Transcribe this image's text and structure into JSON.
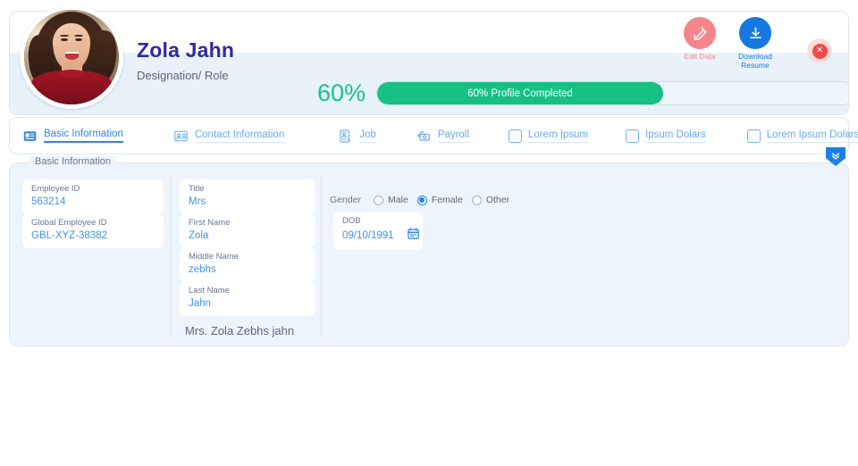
{
  "header": {
    "name": "Zola Jahn",
    "role": "Designation/ Role",
    "avatar_icon": "user-avatar-photo",
    "actions": [
      {
        "id": "edit-data",
        "label": "Edit Data",
        "icon": "pencil-square-icon",
        "color": "#f4868b"
      },
      {
        "id": "download-resume",
        "label": "Download Resume",
        "icon": "download-icon",
        "color": "#1678e0"
      }
    ],
    "close_icon": "close-icon"
  },
  "progress": {
    "percent_label": "60%",
    "bar_text": "60% Profile Completed",
    "value": 60,
    "fill_color": "#17c083",
    "track_color": "#eef5fb"
  },
  "tabs": [
    {
      "label": "Basic Information",
      "icon": "article-card-icon",
      "active": true,
      "type": "icon"
    },
    {
      "label": "Contact Information",
      "icon": "id-card-icon",
      "active": false,
      "type": "icon"
    },
    {
      "label": "Job",
      "icon": "job-badge-icon",
      "active": false,
      "type": "icon"
    },
    {
      "label": "Payroll",
      "icon": "payroll-money-icon",
      "active": false,
      "type": "icon"
    },
    {
      "label": "Lorem Ipsum",
      "icon": "checkbox-icon",
      "active": false,
      "type": "checkbox"
    },
    {
      "label": "Ipsum Dolars",
      "icon": "checkbox-icon",
      "active": false,
      "type": "checkbox"
    },
    {
      "label": "Lorem Ipsum Dolars",
      "icon": "checkbox-icon",
      "active": false,
      "type": "checkbox"
    }
  ],
  "expand_badge": {
    "icon": "double-chevron-down-icon"
  },
  "section": {
    "legend": "Basic Information",
    "fields": {
      "employee_id": {
        "label": "Employee ID",
        "value": "563214"
      },
      "global_employee_id": {
        "label": "Global Employee ID",
        "value": "GBL-XYZ-38382"
      },
      "title": {
        "label": "Title",
        "value": "Mrs"
      },
      "first_name": {
        "label": "First Name",
        "value": "Zola"
      },
      "middle_name": {
        "label": "Middle Name",
        "value": "zebhs"
      },
      "last_name": {
        "label": "Last Name",
        "value": "Jahn"
      },
      "dob": {
        "label": "DOB",
        "value": "09/10/1991",
        "icon": "calendar-icon"
      }
    },
    "full_name_display": "Mrs. Zola Zebhs jahn",
    "gender": {
      "label": "Gender",
      "options": [
        {
          "label": "Male",
          "selected": false
        },
        {
          "label": "Female",
          "selected": true
        },
        {
          "label": "Other",
          "selected": false
        }
      ]
    }
  }
}
